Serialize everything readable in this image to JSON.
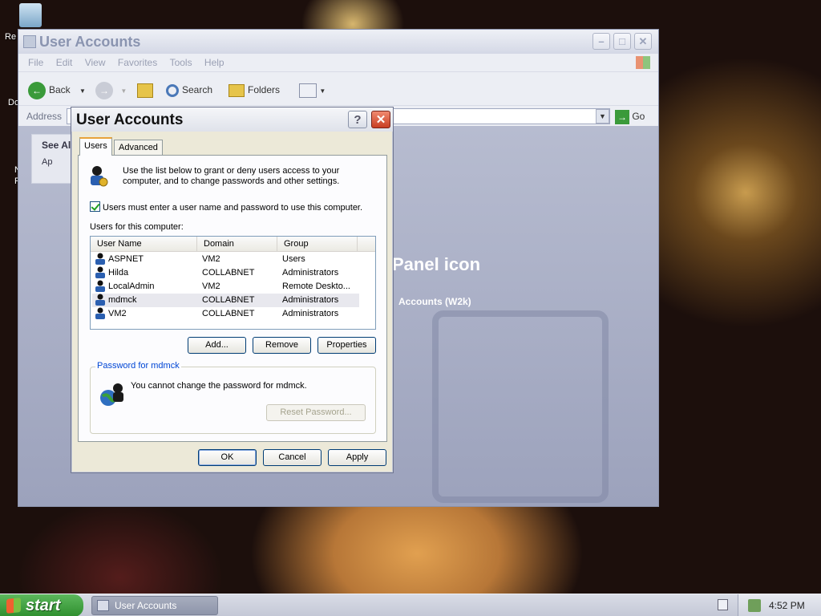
{
  "desktop": {
    "icons": [
      {
        "label": "Re"
      },
      {
        "label": "Do"
      },
      {
        "label": "N"
      },
      {
        "label": "F"
      }
    ]
  },
  "explorer": {
    "title": "User Accounts",
    "menu": [
      "File",
      "Edit",
      "View",
      "Favorites",
      "Tools",
      "Help"
    ],
    "toolbar": {
      "back": "Back",
      "search": "Search",
      "folders": "Folders"
    },
    "address_label": "Address",
    "go_label": "Go",
    "see_also": {
      "heading": "See Al",
      "item": "Ap"
    },
    "panel_icon_text": "Panel icon",
    "accounts_text": "Accounts (W2k)"
  },
  "dialog": {
    "title": "User Accounts",
    "help_glyph": "?",
    "close_glyph": "✕",
    "tabs": [
      "Users",
      "Advanced"
    ],
    "intro": "Use the list below to grant or deny users access to your computer, and to change passwords and other settings.",
    "require_login": {
      "label": "Users must enter a user name and password to use this computer.",
      "checked": true
    },
    "users_label": "Users for this computer:",
    "columns": [
      "User Name",
      "Domain",
      "Group"
    ],
    "users": [
      {
        "name": "ASPNET",
        "domain": "VM2",
        "group": "Users"
      },
      {
        "name": "Hilda",
        "domain": "COLLABNET",
        "group": "Administrators"
      },
      {
        "name": "LocalAdmin",
        "domain": "VM2",
        "group": "Remote Deskto..."
      },
      {
        "name": "mdmck",
        "domain": "COLLABNET",
        "group": "Administrators"
      },
      {
        "name": "VM2",
        "domain": "COLLABNET",
        "group": "Administrators"
      }
    ],
    "selected_user": "mdmck",
    "buttons": {
      "add": "Add...",
      "remove": "Remove",
      "properties": "Properties"
    },
    "password_group": {
      "legend": "Password for mdmck",
      "message": "You cannot change the password for mdmck.",
      "reset": "Reset Password..."
    },
    "footer": {
      "ok": "OK",
      "cancel": "Cancel",
      "apply": "Apply"
    }
  },
  "taskbar": {
    "start": "start",
    "task": "User Accounts",
    "clock": "4:52 PM"
  },
  "colors": {
    "xp_green": "#2f8f2f",
    "dialog_face": "#ece9d8",
    "close_red": "#c83e22",
    "legend_blue": "#0046d5"
  }
}
